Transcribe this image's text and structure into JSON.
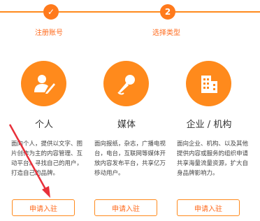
{
  "steps": [
    {
      "number": "✓",
      "label": "注册账号"
    },
    {
      "number": "2",
      "label": "选择类型"
    }
  ],
  "cards": [
    {
      "icon": "person-pen-icon",
      "title": "个人",
      "description": "面向个人，提供以文字、图片创作为主的内容管理、互动平台。寻找自己的用户，打造自己的品牌。",
      "button": "申请入驻"
    },
    {
      "icon": "microphone-icon",
      "title": "媒体",
      "description": "面向报纸，杂志，广播电视台，电台，互联网等媒体开放内容发布平台，共享亿万移动用户。",
      "button": "申请入驻"
    },
    {
      "icon": "building-icon",
      "title": "企业 / 机构",
      "description": "面向企业、机构、以及其他提供内容或服务的组织申请共享海量流量资源，扩大自身品牌影响力。",
      "button": "申请入驻"
    }
  ],
  "colors": {
    "accent": "#ff8a1c",
    "annotation_arrow": "#e8303a"
  }
}
